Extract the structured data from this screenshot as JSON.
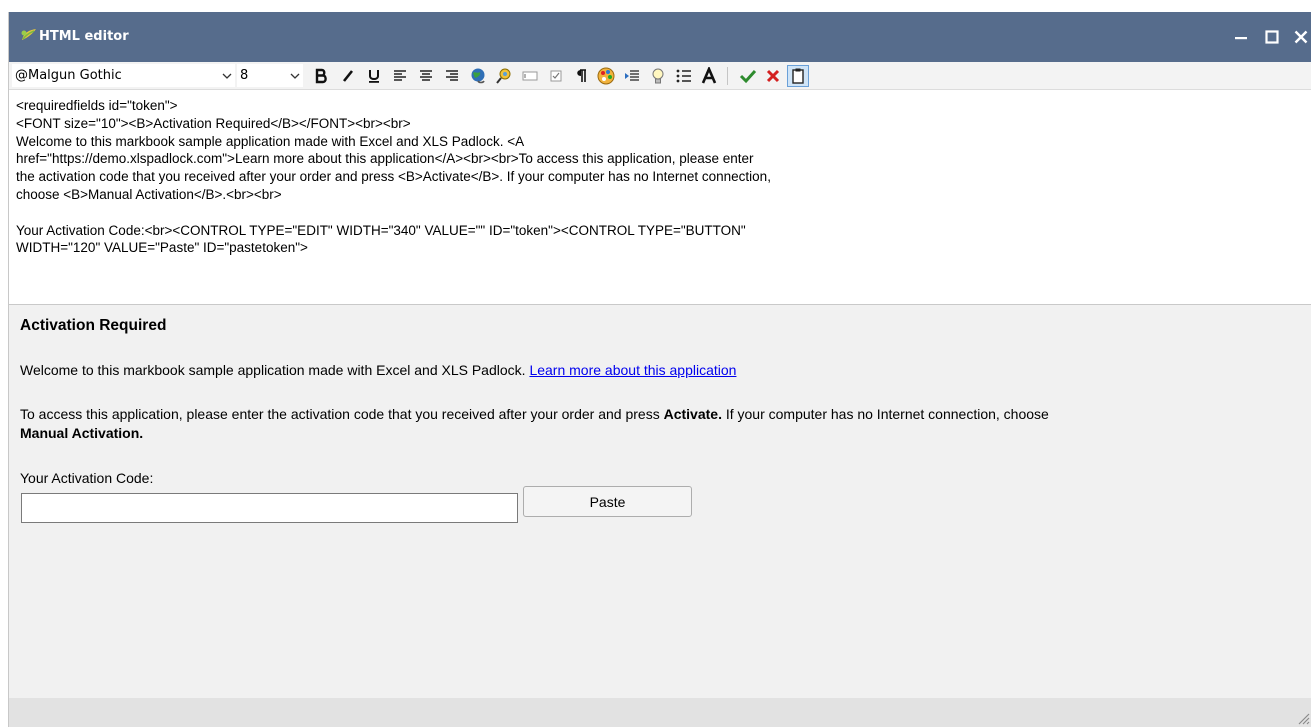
{
  "window": {
    "title": "HTML editor",
    "controls": {
      "minimize": "minimize",
      "maximize": "maximize",
      "close": "close"
    }
  },
  "toolbar": {
    "font_name": "@Malgun Gothic",
    "font_size": "8",
    "buttons": [
      "bold",
      "italic",
      "underline",
      "align-left",
      "align-center",
      "align-right",
      "insert-link",
      "insert-image",
      "insert-edit-control",
      "insert-checkbox",
      "paragraph-mark",
      "color-palette",
      "indent",
      "lightbulb",
      "bullet-list",
      "text-style",
      "accept",
      "reject",
      "clipboard"
    ]
  },
  "source": {
    "lines": [
      "<requiredfields id=\"token\">",
      "<FONT size=\"10\"><B>Activation Required</B></FONT><br><br>",
      "Welcome to this markbook sample application made with Excel and XLS Padlock. <A",
      "href=\"https://demo.xlspadlock.com\">Learn more about this application</A><br><br>To access this application, please enter",
      "the activation code that you received after your order and press <B>Activate</B>. If your computer has no Internet connection,",
      "choose <B>Manual Activation</B>.<br><br>",
      "",
      "Your Activation Code:<br><CONTROL TYPE=\"EDIT\" WIDTH=\"340\" VALUE=\"\" ID=\"token\"><CONTROL TYPE=\"BUTTON\"",
      "WIDTH=\"120\" VALUE=\"Paste\" ID=\"pastetoken\">"
    ]
  },
  "preview": {
    "heading": "Activation Required",
    "welcome_text": "Welcome to this markbook sample application made with Excel and XLS Padlock. ",
    "link_text": "Learn more about this application",
    "access_text_1": "To access this application, please enter the activation code that you received after your order and press ",
    "access_bold_1": "Activate.",
    "access_text_2": " If your computer has no Internet connection, choose ",
    "access_bold_2": "Manual Activation.",
    "code_label": "Your Activation Code:",
    "code_value": "",
    "paste_label": "Paste"
  },
  "colors": {
    "titlebar": "#566c8c",
    "accept": "#2e8b2e",
    "reject": "#d42020",
    "link": "#0000ee"
  }
}
